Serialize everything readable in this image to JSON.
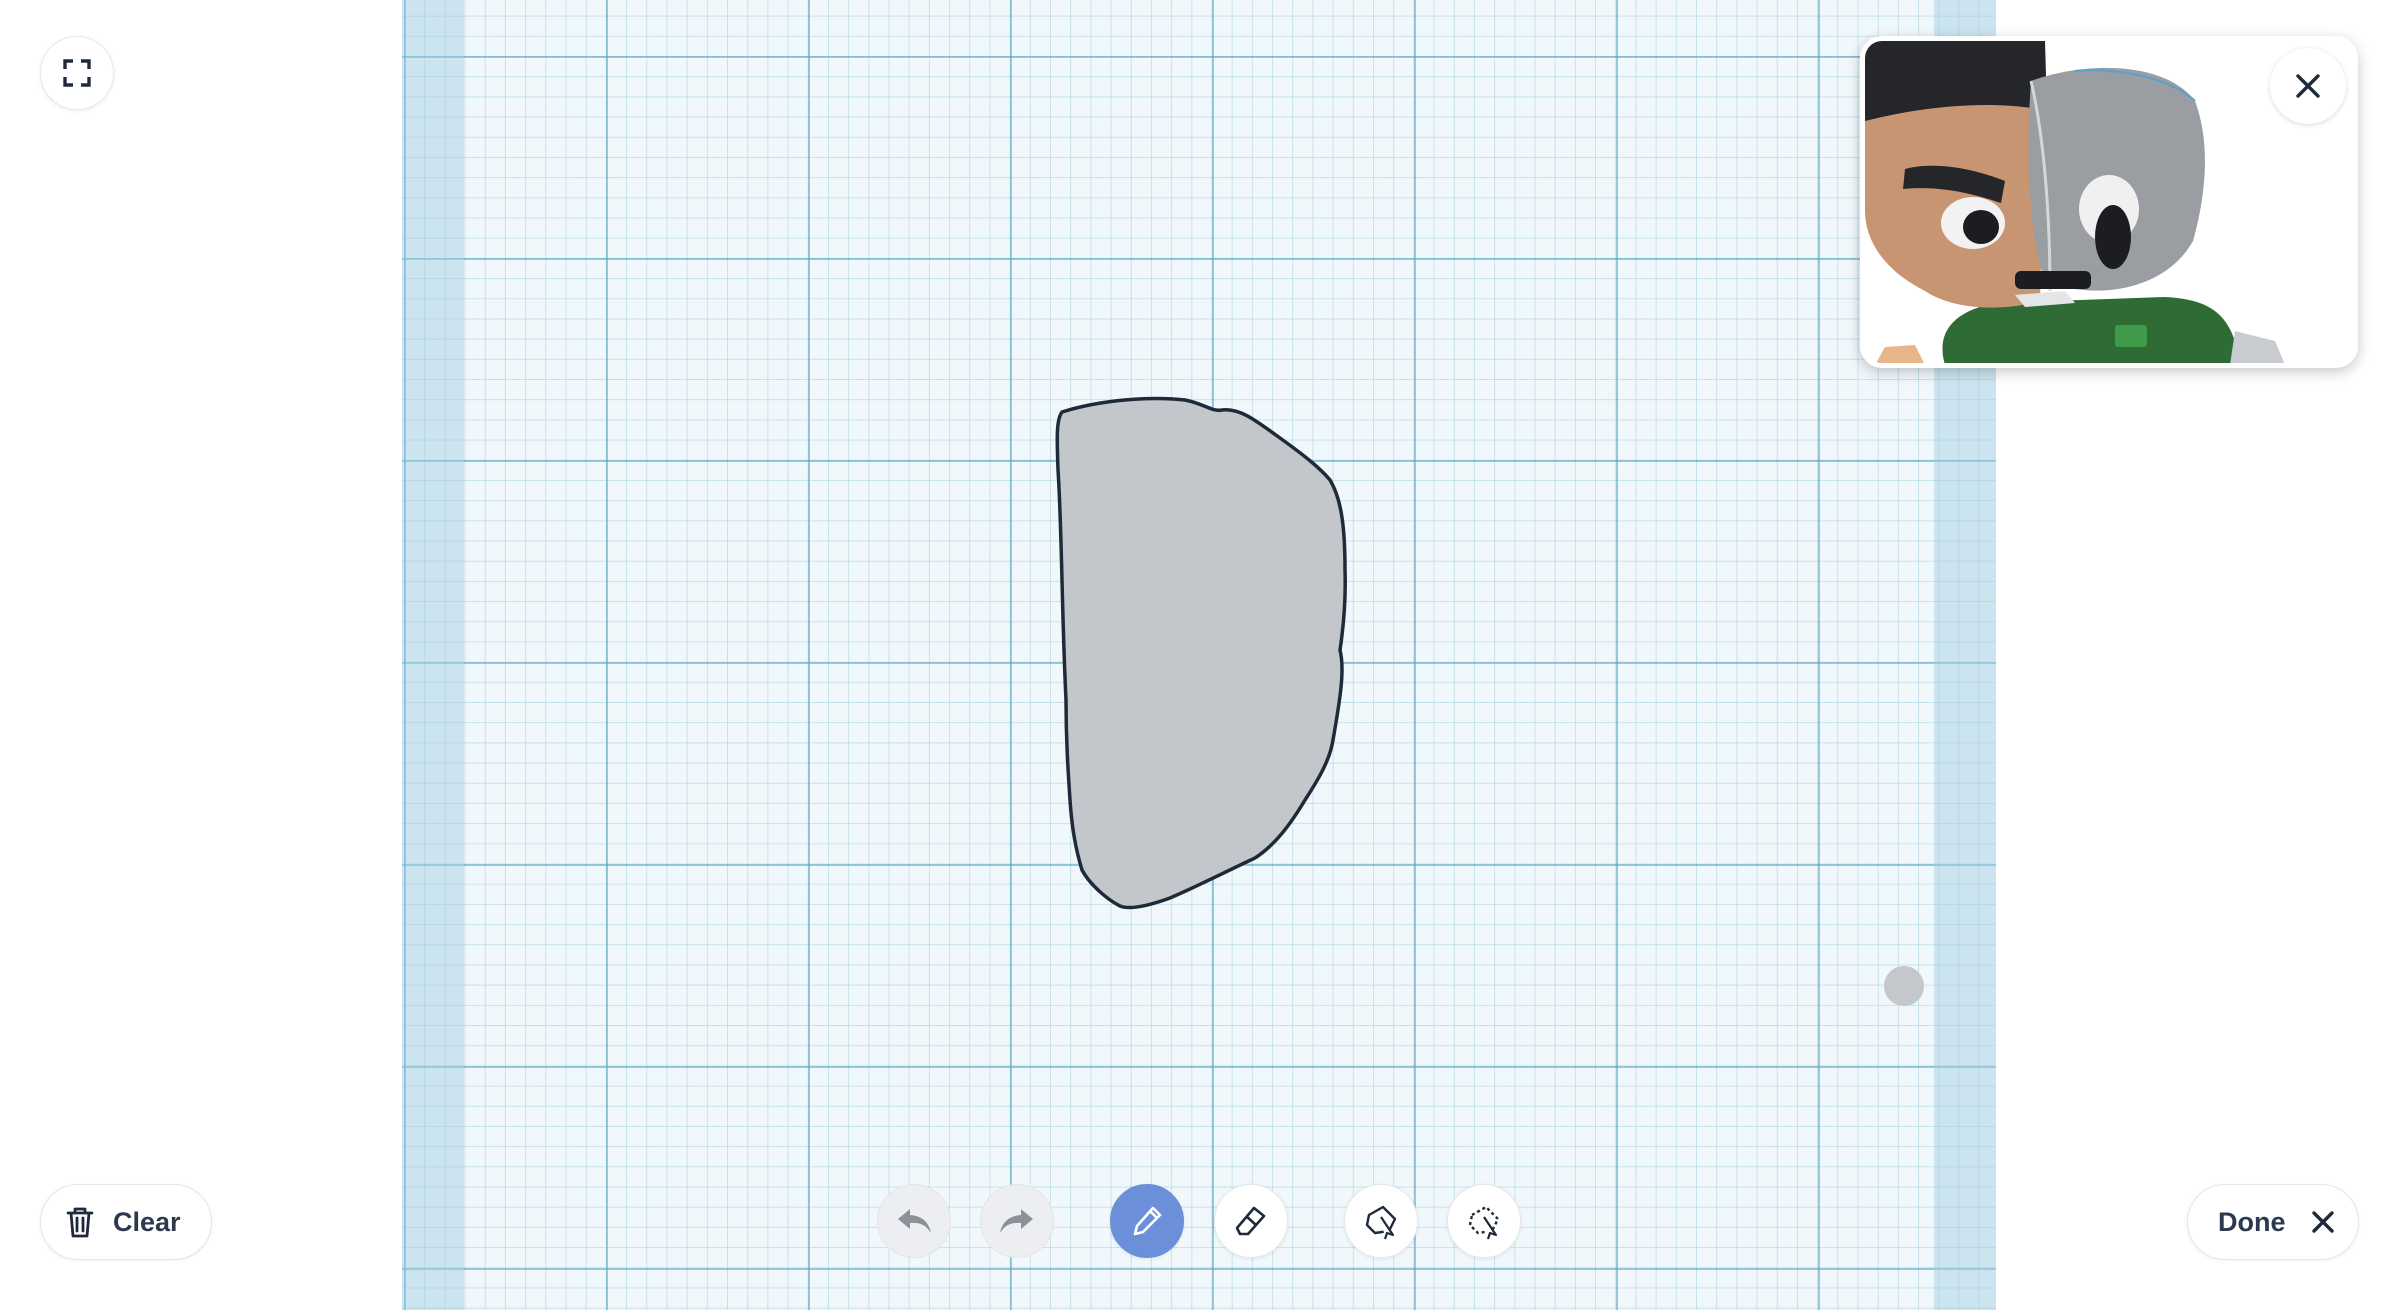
{
  "toolbar": {
    "clear_label": "Clear",
    "done_label": "Done",
    "tools": [
      "undo",
      "redo",
      "pencil",
      "eraser",
      "lasso-add",
      "lasso-subtract"
    ],
    "active_tool": "pencil"
  },
  "icons": {
    "fullscreen": "fullscreen-icon",
    "clear": "trash-icon",
    "done": "close-icon",
    "undo": "undo-icon",
    "redo": "redo-icon",
    "pencil": "pencil-icon",
    "eraser": "eraser-icon",
    "lasso_add": "lasso-add-icon",
    "lasso_subtract": "lasso-subtract-icon",
    "preview_close": "close-icon"
  },
  "colors": {
    "accent": "#6b8fd8",
    "shape_fill": "#c3c7cb",
    "shape_stroke": "#1e2a3a",
    "grid_background": "#f1f8fb",
    "text": "#2c3a4f"
  }
}
